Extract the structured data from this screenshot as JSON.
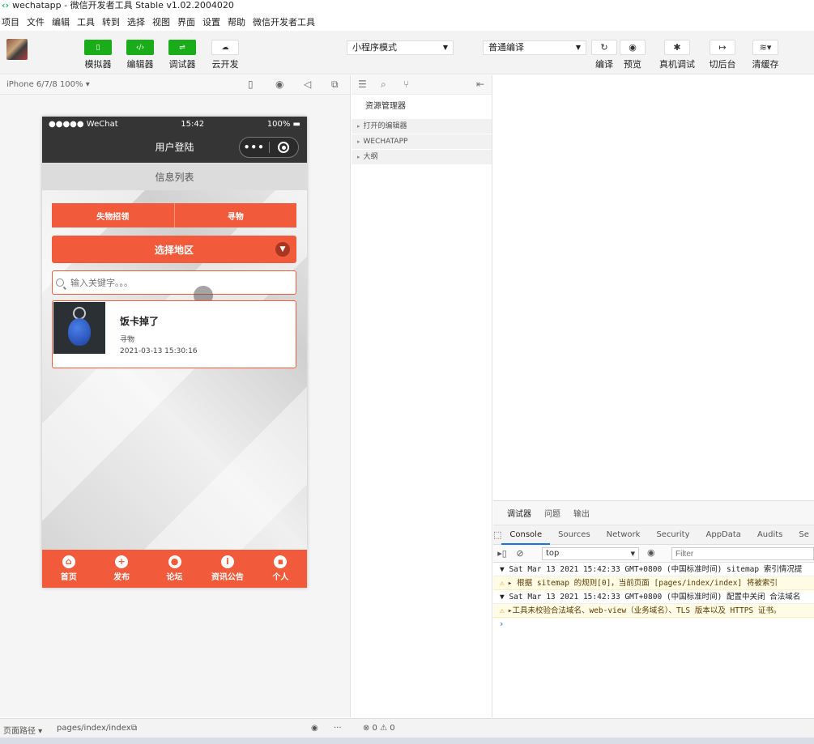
{
  "window": {
    "title": "wechatapp - 微信开发者工具 Stable v1.02.2004020"
  },
  "menu": [
    "项目",
    "文件",
    "编辑",
    "工具",
    "转到",
    "选择",
    "视图",
    "界面",
    "设置",
    "帮助",
    "微信开发者工具"
  ],
  "toolbar": {
    "simulator": "模拟器",
    "editor": "编辑器",
    "debugger": "调试器",
    "cloud": "云开发",
    "mode_select": "小程序模式",
    "compile_select": "普通编译",
    "compile": "编译",
    "preview": "预览",
    "real_debug": "真机调试",
    "background": "切后台",
    "clear_cache": "清缓存"
  },
  "simulator": {
    "device": "iPhone 6/7/8 100% ▾",
    "status": {
      "carrier": "●●●●● WeChat",
      "time": "15:42",
      "battery": "100%"
    },
    "nav_title": "用户登陆",
    "capsule_dots": "•••",
    "list_title": "信息列表",
    "tabs": [
      "失物招领",
      "寻物"
    ],
    "region_label": "选择地区",
    "search_placeholder": "输入关键字。。。",
    "card": {
      "title": "饭卡掉了",
      "category": "寻物",
      "date": "2021-03-13 15:30:16"
    },
    "tabbar": [
      {
        "icon": "⌂",
        "label": "首页"
      },
      {
        "icon": "+",
        "label": "发布"
      },
      {
        "icon": "●",
        "label": "论坛"
      },
      {
        "icon": "i",
        "label": "资讯公告"
      },
      {
        "icon": "▪",
        "label": "个人"
      }
    ]
  },
  "explorer": {
    "title": "资源管理器",
    "sections": [
      "打开的编辑器",
      "WECHATAPP",
      "大纲"
    ]
  },
  "debugger": {
    "tabs": [
      "调试器",
      "问题",
      "输出"
    ],
    "devtools_tabs": [
      "Console",
      "Sources",
      "Network",
      "Security",
      "AppData",
      "Audits",
      "Se"
    ],
    "context": "top",
    "filter_placeholder": "Filter",
    "logs": [
      {
        "type": "info",
        "text": "▼ Sat Mar 13 2021 15:42:33 GMT+0800 (中国标准时间) sitemap 索引情况提"
      },
      {
        "type": "warn",
        "text": "▸ 根据 sitemap 的规则[0]，当前页面 [pages/index/index] 将被索引"
      },
      {
        "type": "info",
        "text": "▼ Sat Mar 13 2021 15:42:33 GMT+0800 (中国标准时间) 配置中关闭 合法域名"
      },
      {
        "type": "warn",
        "text": "▸工具未校验合法域名、web-view（业务域名）、TLS 版本以及 HTTPS 证书。"
      }
    ],
    "prompt": "›"
  },
  "footer": {
    "page_path_label": "页面路径 ▾",
    "page_path": "pages/index/index",
    "counts": "⊗ 0 ⚠ 0"
  }
}
